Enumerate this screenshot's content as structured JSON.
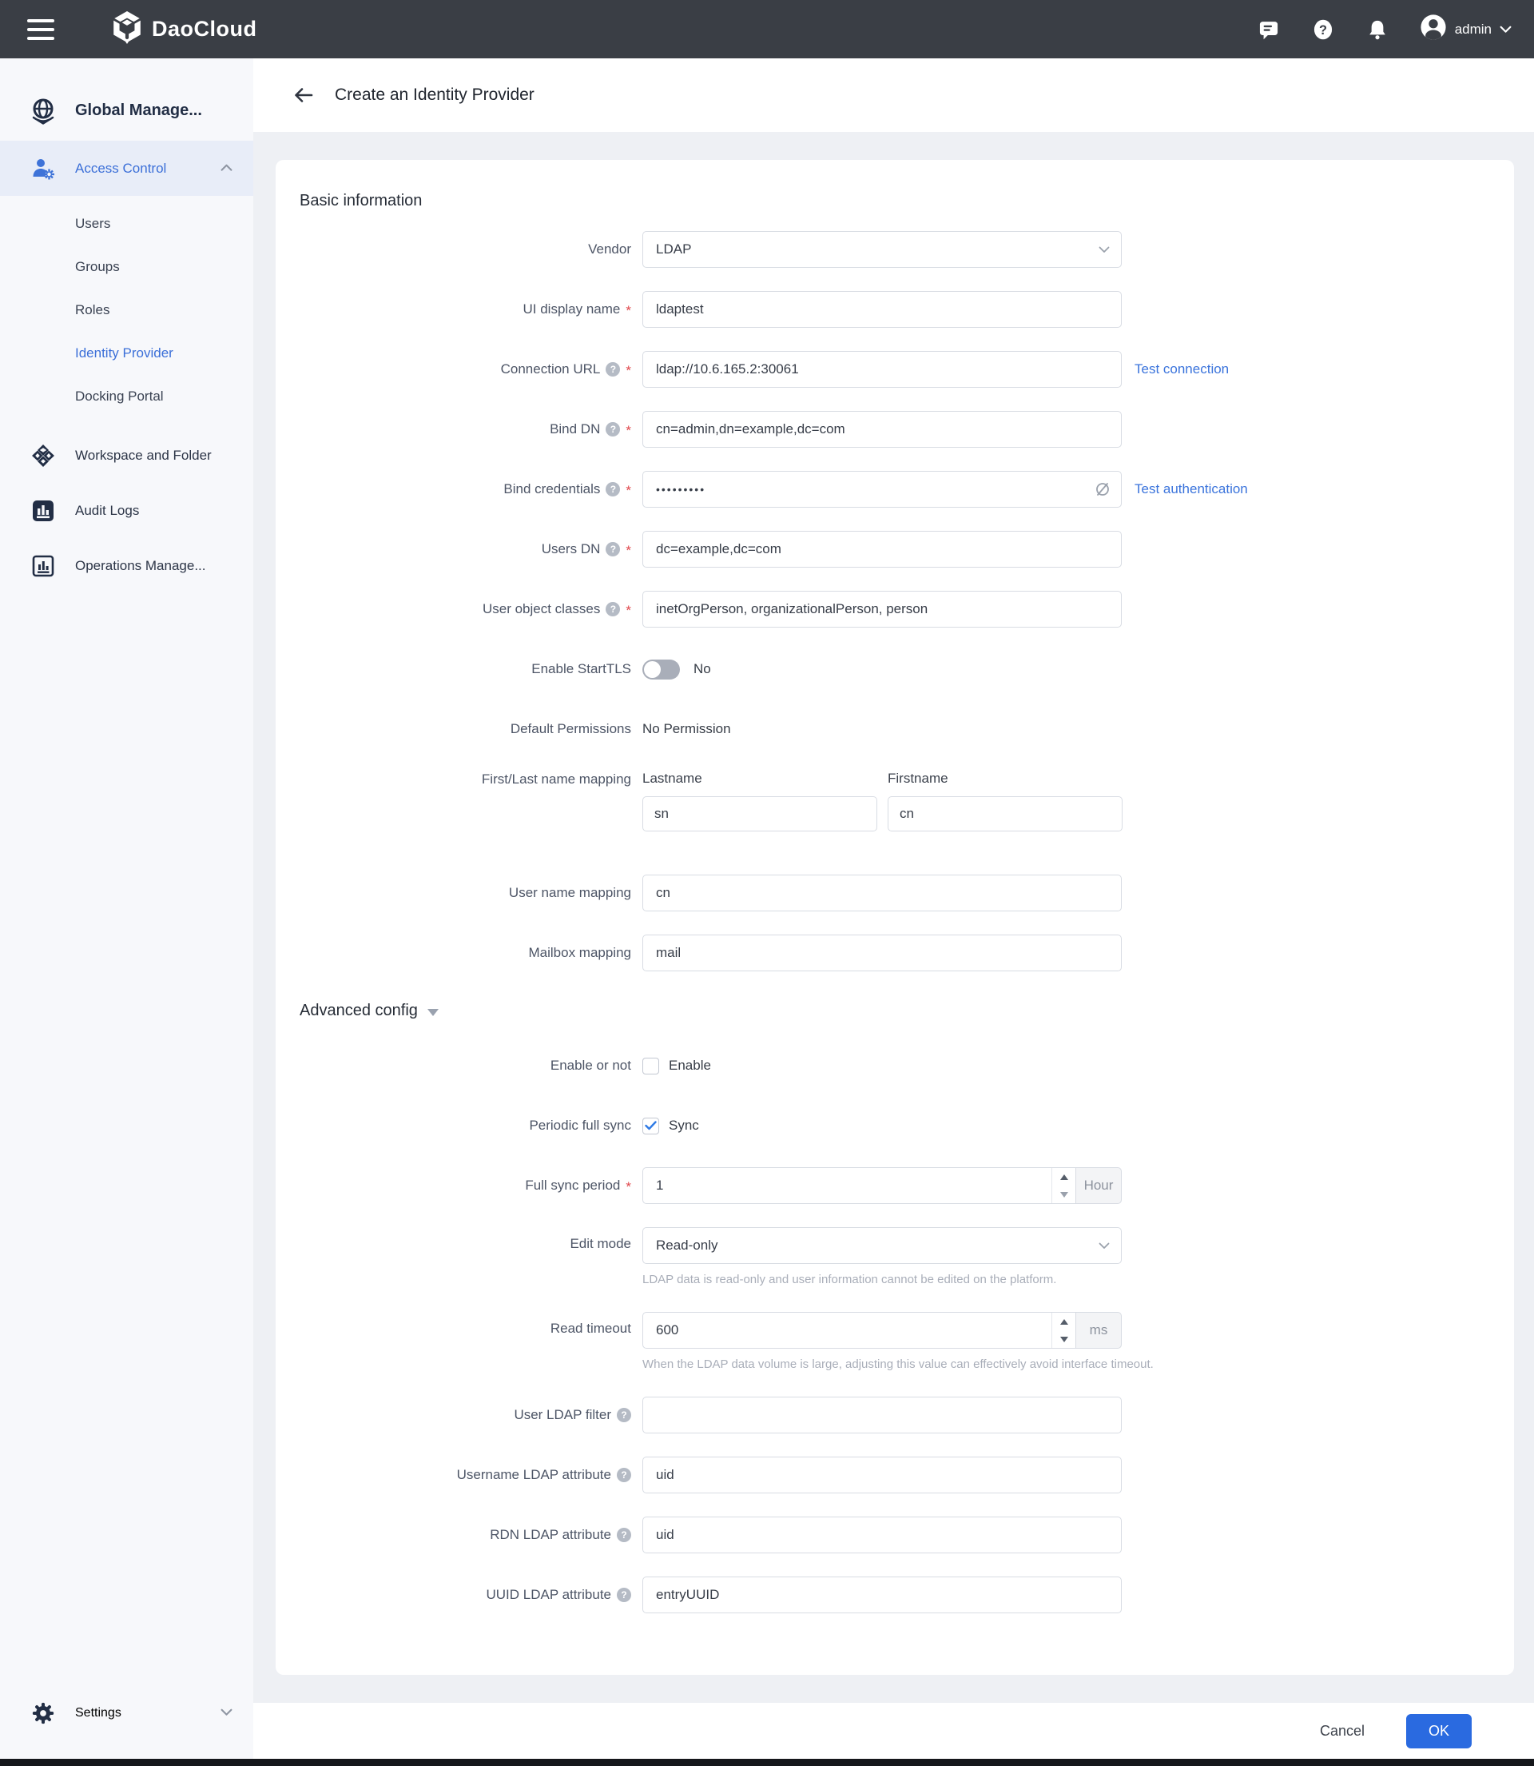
{
  "topbar": {
    "brand": "DaoCloud",
    "user": "admin"
  },
  "sidebar": {
    "root_label": "Global Manage...",
    "access_control": "Access Control",
    "access_items": [
      "Users",
      "Groups",
      "Roles",
      "Identity Provider",
      "Docking Portal"
    ],
    "workspace": "Workspace and Folder",
    "audit_logs": "Audit Logs",
    "operations": "Operations Manage...",
    "settings": "Settings"
  },
  "header": {
    "title": "Create an Identity Provider"
  },
  "form": {
    "section_basic": "Basic information",
    "section_advanced": "Advanced config",
    "vendor": {
      "label": "Vendor",
      "value": "LDAP"
    },
    "ui_display_name": {
      "label": "UI display name",
      "value": "ldaptest"
    },
    "connection_url": {
      "label": "Connection URL",
      "value": "ldap://10.6.165.2:30061",
      "action": "Test connection"
    },
    "bind_dn": {
      "label": "Bind DN",
      "value": "cn=admin,dn=example,dc=com"
    },
    "bind_credentials": {
      "label": "Bind credentials",
      "value": "•••••••••",
      "action": "Test authentication"
    },
    "users_dn": {
      "label": "Users DN",
      "value": "dc=example,dc=com"
    },
    "user_object_classes": {
      "label": "User object classes",
      "value": "inetOrgPerson, organizationalPerson, person"
    },
    "enable_starttls": {
      "label": "Enable StartTLS",
      "value": "No"
    },
    "default_permissions": {
      "label": "Default Permissions",
      "value": "No Permission"
    },
    "name_mapping": {
      "label": "First/Last name mapping",
      "lastname_label": "Lastname",
      "lastname_value": "sn",
      "firstname_label": "Firstname",
      "firstname_value": "cn"
    },
    "user_name_mapping": {
      "label": "User name mapping",
      "value": "cn"
    },
    "mailbox_mapping": {
      "label": "Mailbox mapping",
      "value": "mail"
    },
    "enable_or_not": {
      "label": "Enable or not",
      "checkbox_label": "Enable",
      "checked": false
    },
    "periodic_full_sync": {
      "label": "Periodic full sync",
      "checkbox_label": "Sync",
      "checked": true
    },
    "full_sync_period": {
      "label": "Full sync period",
      "value": "1",
      "unit": "Hour"
    },
    "edit_mode": {
      "label": "Edit mode",
      "value": "Read-only",
      "help": "LDAP data is read-only and user information cannot be edited on the platform."
    },
    "read_timeout": {
      "label": "Read timeout",
      "value": "600",
      "unit": "ms",
      "help": "When the LDAP data volume is large, adjusting this value can effectively avoid interface timeout."
    },
    "user_ldap_filter": {
      "label": "User LDAP filter",
      "value": ""
    },
    "username_ldap_attribute": {
      "label": "Username LDAP attribute",
      "value": "uid"
    },
    "rdn_ldap_attribute": {
      "label": "RDN LDAP attribute",
      "value": "uid"
    },
    "uuid_ldap_attribute": {
      "label": "UUID LDAP attribute",
      "value": "entryUUID"
    }
  },
  "footer": {
    "cancel": "Cancel",
    "ok": "OK"
  },
  "icons": {
    "help": "?",
    "required": "*"
  },
  "colors": {
    "topbar": "#3a3e45",
    "accent_blue": "#3b6fd8",
    "ok_button": "#2a6ae0",
    "sidebar_active_bg": "#e8edf8",
    "page_bg": "#eef0f4"
  }
}
